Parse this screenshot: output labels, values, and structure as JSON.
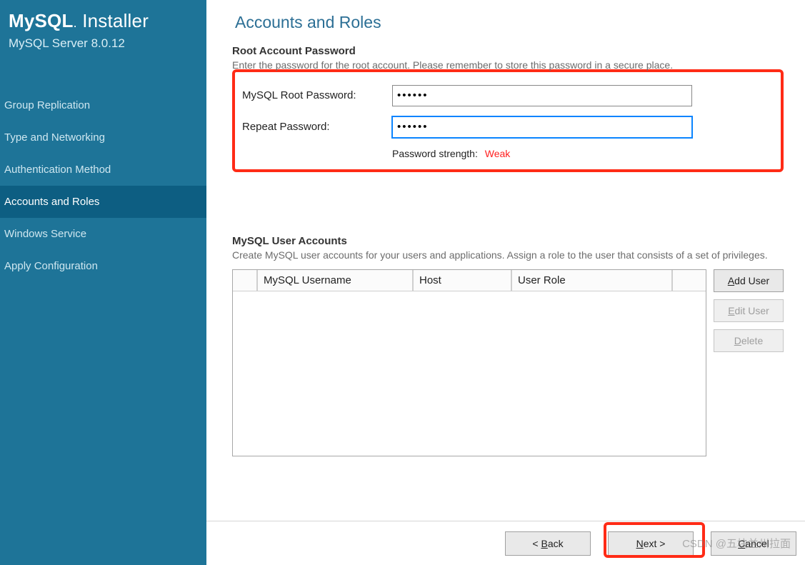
{
  "sidebar": {
    "logo_mysql": "MySQL",
    "logo_installer": "Installer",
    "subtitle": "MySQL Server 8.0.12",
    "items": [
      {
        "label": "Group Replication"
      },
      {
        "label": "Type and Networking"
      },
      {
        "label": "Authentication Method"
      },
      {
        "label": "Accounts and Roles"
      },
      {
        "label": "Windows Service"
      },
      {
        "label": "Apply Configuration"
      }
    ],
    "active_index": 3
  },
  "page": {
    "title": "Accounts and Roles"
  },
  "root_section": {
    "heading": "Root Account Password",
    "desc": "Enter the password for the root account.  Please remember to store this password in a secure place.",
    "label_pw": "MySQL Root Password:",
    "label_repeat": "Repeat Password:",
    "password_value": "••••••",
    "repeat_value": "••••••",
    "strength_label": "Password strength:",
    "strength_value": "Weak"
  },
  "accounts_section": {
    "heading": "MySQL User Accounts",
    "desc": "Create MySQL user accounts for your users and applications. Assign a role to the user that consists of a set of privileges.",
    "columns": {
      "username": "MySQL Username",
      "host": "Host",
      "role": "User Role"
    },
    "rows": [],
    "buttons": {
      "add": "Add User",
      "edit": "Edit User",
      "delete": "Delete"
    }
  },
  "footer": {
    "back": "< Back",
    "next": "Next >",
    "cancel": "Cancel"
  },
  "watermark": "CSDN @五块兰州拉面"
}
